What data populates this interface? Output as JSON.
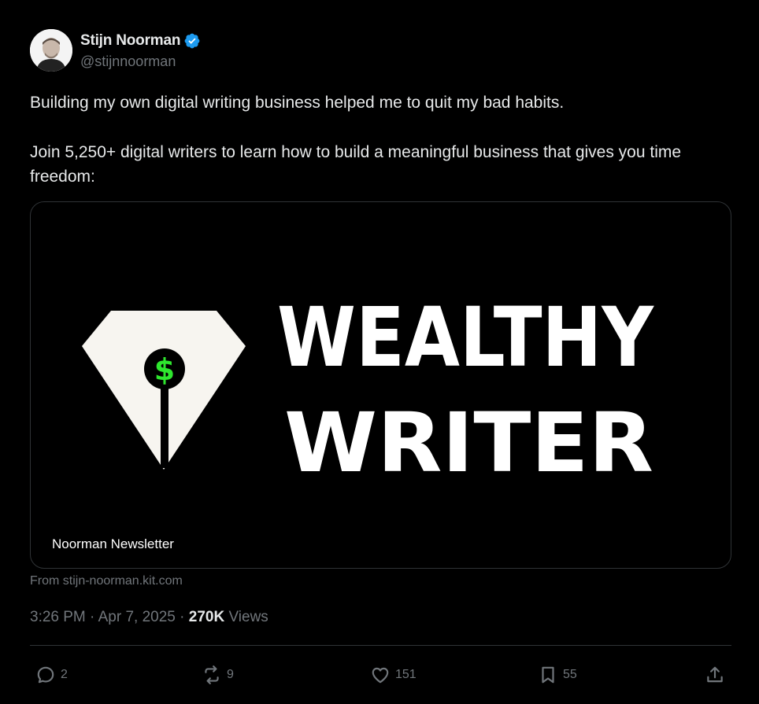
{
  "author": {
    "name": "Stijn Noorman",
    "handle": "@stijnnoorman",
    "verified": true,
    "verified_color": "#1d9bf0"
  },
  "tweet": {
    "paragraphs": [
      "Building my own digital writing business helped me to quit my bad habits.",
      "Join 5,250+ digital writers to learn how to build a meaningful business that gives you time freedom:"
    ]
  },
  "card": {
    "logo_line1": "WEALTHY",
    "logo_line2": "WRITER",
    "logo_symbol": "$",
    "logo_symbol_color": "#2ee62e",
    "label": "Noorman Newsletter",
    "source": "From stijn-noorman.kit.com"
  },
  "meta": {
    "time": "3:26 PM",
    "separator": "·",
    "date": "Apr 7, 2025",
    "views_count": "270K",
    "views_label": "Views"
  },
  "actions": {
    "replies": {
      "icon": "reply-icon",
      "count": "2"
    },
    "reposts": {
      "icon": "repost-icon",
      "count": "9"
    },
    "likes": {
      "icon": "heart-icon",
      "count": "151"
    },
    "bookmarks": {
      "icon": "bookmark-icon",
      "count": "55"
    },
    "share": {
      "icon": "share-icon"
    }
  },
  "colors": {
    "background": "#000000",
    "text_primary": "#e7e9ea",
    "text_secondary": "#71767b",
    "border": "#2f3336"
  }
}
